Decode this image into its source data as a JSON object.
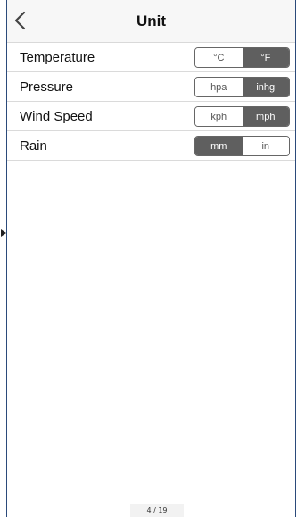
{
  "header": {
    "title": "Unit",
    "back_icon": "chevron-left-icon"
  },
  "settings": [
    {
      "label": "Temperature",
      "options": [
        "°C",
        "°F"
      ],
      "selected": 1
    },
    {
      "label": "Pressure",
      "options": [
        "hpa",
        "inhg"
      ],
      "selected": 1
    },
    {
      "label": "Wind Speed",
      "options": [
        "kph",
        "mph"
      ],
      "selected": 1
    },
    {
      "label": "Rain",
      "options": [
        "mm",
        "in"
      ],
      "selected": 0
    }
  ],
  "footer": {
    "page_indicator": "4 / 19"
  },
  "colors": {
    "selected_segment": "#5f5f5f",
    "unselected_segment": "#ffffff",
    "nav_background": "#f7f7f7"
  }
}
